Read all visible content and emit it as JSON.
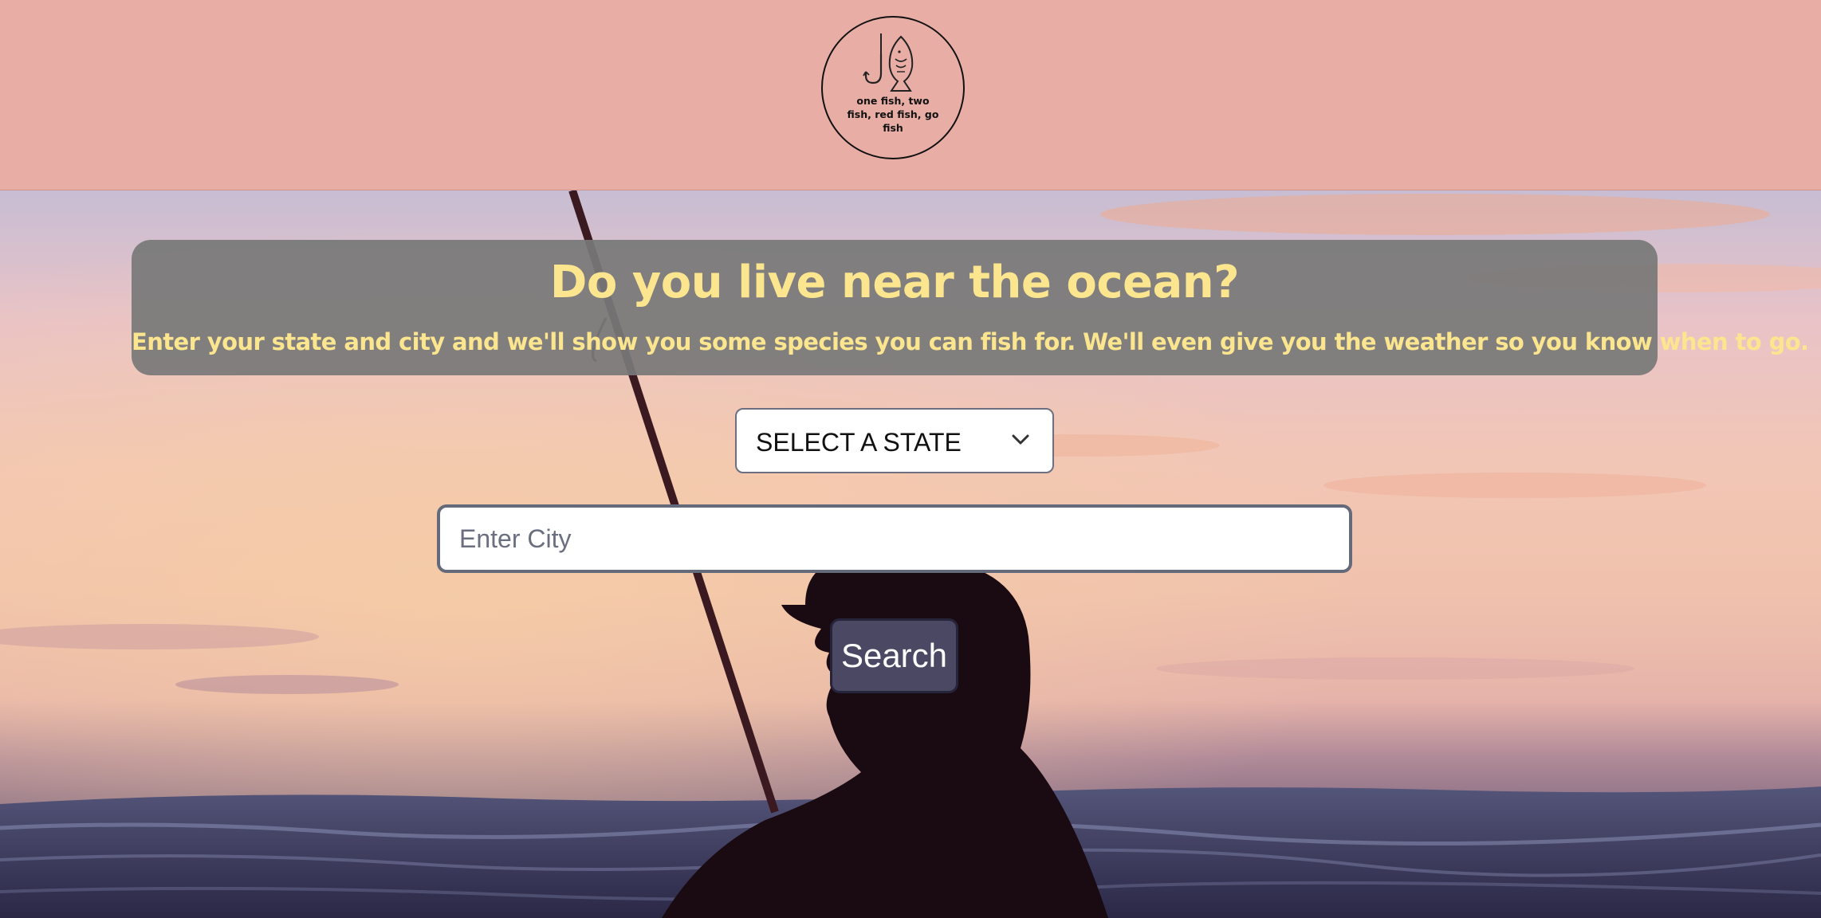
{
  "header": {
    "logo_text": "one fish, two fish, red fish, go fish",
    "logo_icons": [
      "fishhook-icon",
      "fish-icon"
    ]
  },
  "hero": {
    "title": "Do you live near the ocean?",
    "subtitle": "Enter your state and city and we'll show you some species you can fish for. We'll even give you the weather so you know when to go."
  },
  "form": {
    "state_select": {
      "selected": "SELECT A STATE",
      "icon": "chevron-down-icon"
    },
    "city_input": {
      "value": "",
      "placeholder": "Enter City"
    },
    "search_label": "Search"
  },
  "colors": {
    "header_bg": "#e8aea6",
    "accent_text": "#fbe58f",
    "panel_bg": "#787878",
    "button_bg": "#4b4863"
  }
}
